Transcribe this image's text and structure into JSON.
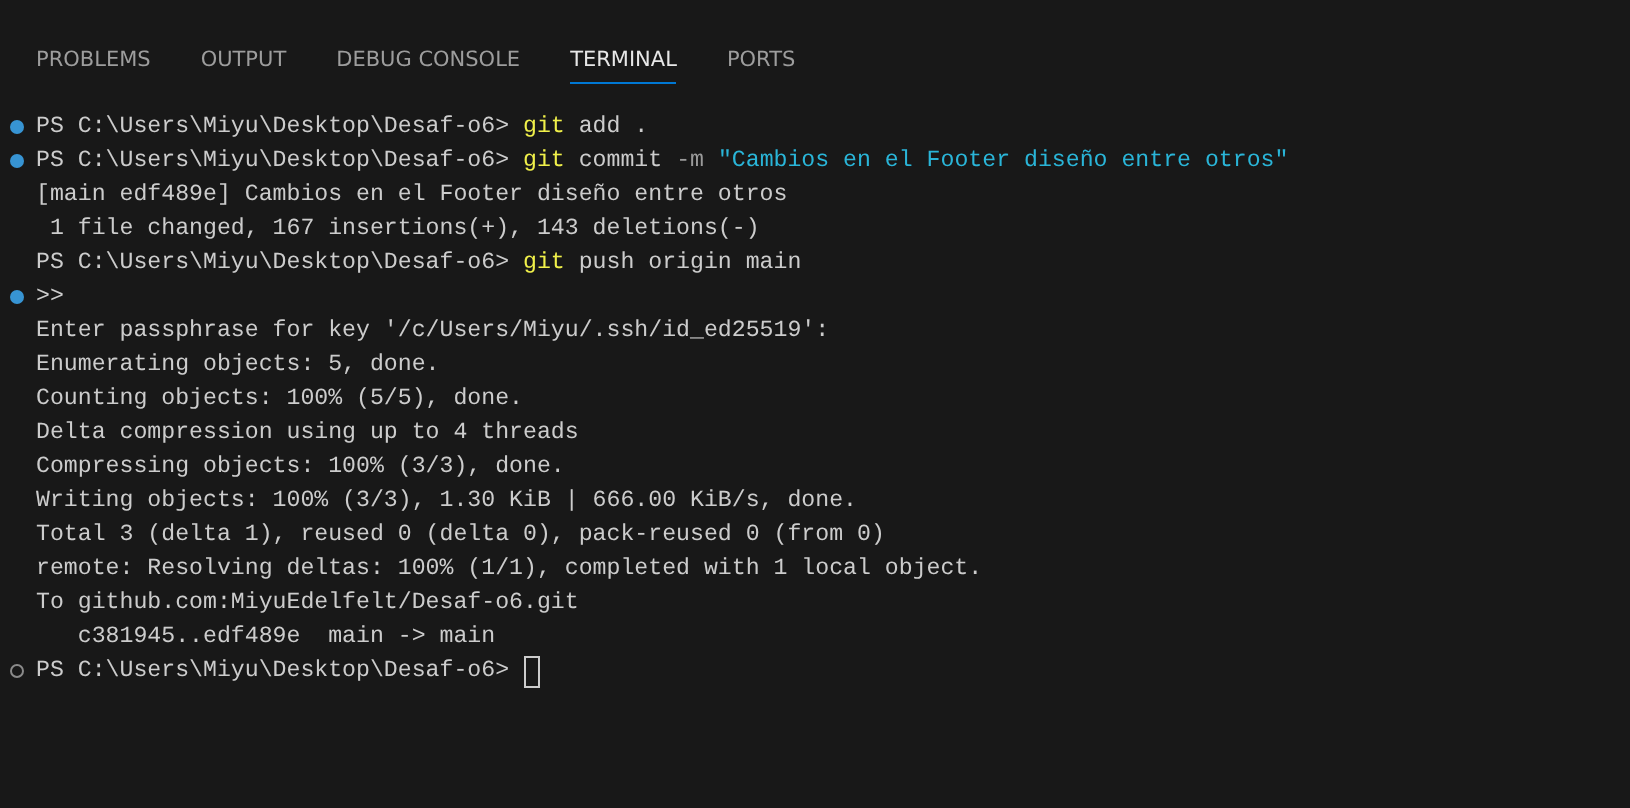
{
  "tabs": [
    {
      "label": "PROBLEMS",
      "selected": false
    },
    {
      "label": "OUTPUT",
      "selected": false
    },
    {
      "label": "DEBUG CONSOLE",
      "selected": false
    },
    {
      "label": "TERMINAL",
      "selected": true
    },
    {
      "label": "PORTS",
      "selected": false
    }
  ],
  "terminal_lines": [
    {
      "dot": true,
      "dot_filled": true,
      "segments": [
        {
          "kind": "prompt",
          "text": "PS C:\\Users\\Miyu\\Desktop\\Desaf-o6> "
        },
        {
          "kind": "command",
          "text": "git"
        },
        {
          "kind": "plain",
          "text": " add ."
        }
      ]
    },
    {
      "dot": true,
      "dot_filled": true,
      "segments": [
        {
          "kind": "prompt",
          "text": "PS C:\\Users\\Miyu\\Desktop\\Desaf-o6> "
        },
        {
          "kind": "command",
          "text": "git"
        },
        {
          "kind": "plain",
          "text": " commit "
        },
        {
          "kind": "flag",
          "text": "-m"
        },
        {
          "kind": "string",
          "text": " \"Cambios en el Footer diseño entre otros\""
        }
      ]
    },
    {
      "dot": false,
      "segments": [
        {
          "kind": "plain",
          "text": "[main edf489e] Cambios en el Footer diseño entre otros"
        }
      ]
    },
    {
      "dot": false,
      "segments": [
        {
          "kind": "plain",
          "text": " 1 file changed, 167 insertions(+), 143 deletions(-)"
        }
      ]
    },
    {
      "dot": false,
      "segments": [
        {
          "kind": "prompt",
          "text": "PS C:\\Users\\Miyu\\Desktop\\Desaf-o6> "
        },
        {
          "kind": "command",
          "text": "git"
        },
        {
          "kind": "plain",
          "text": " push origin main"
        }
      ]
    },
    {
      "dot": true,
      "dot_filled": true,
      "segments": [
        {
          "kind": "plain",
          "text": ">>"
        }
      ]
    },
    {
      "dot": false,
      "segments": [
        {
          "kind": "plain",
          "text": "Enter passphrase for key '/c/Users/Miyu/.ssh/id_ed25519':"
        }
      ]
    },
    {
      "dot": false,
      "segments": [
        {
          "kind": "plain",
          "text": "Enumerating objects: 5, done."
        }
      ]
    },
    {
      "dot": false,
      "segments": [
        {
          "kind": "plain",
          "text": "Counting objects: 100% (5/5), done."
        }
      ]
    },
    {
      "dot": false,
      "segments": [
        {
          "kind": "plain",
          "text": "Delta compression using up to 4 threads"
        }
      ]
    },
    {
      "dot": false,
      "segments": [
        {
          "kind": "plain",
          "text": "Compressing objects: 100% (3/3), done."
        }
      ]
    },
    {
      "dot": false,
      "segments": [
        {
          "kind": "plain",
          "text": "Writing objects: 100% (3/3), 1.30 KiB | 666.00 KiB/s, done."
        }
      ]
    },
    {
      "dot": false,
      "segments": [
        {
          "kind": "plain",
          "text": "Total 3 (delta 1), reused 0 (delta 0), pack-reused 0 (from 0)"
        }
      ]
    },
    {
      "dot": false,
      "segments": [
        {
          "kind": "plain",
          "text": "remote: Resolving deltas: 100% (1/1), completed with 1 local object."
        }
      ]
    },
    {
      "dot": false,
      "segments": [
        {
          "kind": "plain",
          "text": "To github.com:MiyuEdelfelt/Desaf-o6.git"
        }
      ]
    },
    {
      "dot": false,
      "segments": [
        {
          "kind": "plain",
          "text": "   c381945..edf489e  main -> main"
        }
      ]
    },
    {
      "dot": true,
      "dot_filled": false,
      "cursor": true,
      "segments": [
        {
          "kind": "prompt",
          "text": "PS C:\\Users\\Miyu\\Desktop\\Desaf-o6> "
        }
      ]
    }
  ]
}
